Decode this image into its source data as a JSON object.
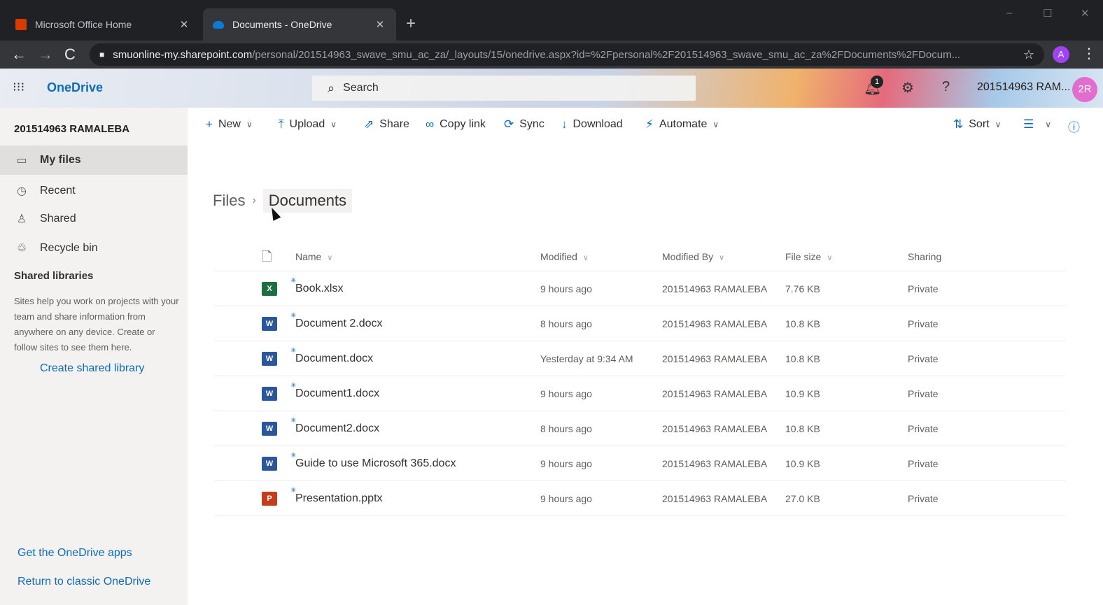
{
  "browser": {
    "tabs": [
      {
        "title": "Microsoft Office Home",
        "close": "✕",
        "icon": "office-icon"
      },
      {
        "title": "Documents - OneDrive",
        "close": "✕",
        "icon": "onedrive-cloud-icon"
      }
    ],
    "new_tab": "+",
    "window_controls": {
      "minimize": "–",
      "maximize": "☐",
      "close": "✕"
    },
    "url_host": "smuonline-my.sharepoint.com",
    "url_path": "/personal/201514963_swave_smu_ac_za/_layouts/15/onedrive.aspx?id=%2Fpersonal%2F201514963_swave_smu_ac_za%2FDocuments%2FDocum...",
    "profile_initial": "A"
  },
  "suite": {
    "app_name": "OneDrive",
    "search_placeholder": "Search",
    "notification_count": "1",
    "user_name": "201514963 RAM...",
    "avatar_initials": "2R"
  },
  "leftnav": {
    "owner": "201514963 RAMALEBA",
    "items": [
      {
        "label": "My files",
        "icon": "folder-icon",
        "selected": true
      },
      {
        "label": "Recent",
        "icon": "clock-icon"
      },
      {
        "label": "Shared",
        "icon": "people-icon"
      },
      {
        "label": "Recycle bin",
        "icon": "recycle-bin-icon"
      }
    ],
    "shared_libraries_heading": "Shared libraries",
    "shared_libraries_text": "Sites help you work on projects with your team and share information from anywhere on any device. Create or follow sites to see them here.",
    "create_shared_library": "Create shared library",
    "get_apps": "Get the OneDrive apps",
    "return_classic": "Return to classic OneDrive"
  },
  "commands": {
    "new": "New",
    "upload": "Upload",
    "share": "Share",
    "copy_link": "Copy link",
    "sync": "Sync",
    "download": "Download",
    "automate": "Automate",
    "sort": "Sort"
  },
  "breadcrumb": {
    "root": "Files",
    "current": "Documents"
  },
  "columns": {
    "name": "Name",
    "modified": "Modified",
    "modified_by": "Modified By",
    "file_size": "File size",
    "sharing": "Sharing"
  },
  "files": [
    {
      "name": "Book.xlsx",
      "type": "excel",
      "modified": "9 hours ago",
      "modified_by": "201514963 RAMALEBA",
      "size": "7.76 KB",
      "sharing": "Private"
    },
    {
      "name": "Document 2.docx",
      "type": "word",
      "modified": "8 hours ago",
      "modified_by": "201514963 RAMALEBA",
      "size": "10.8 KB",
      "sharing": "Private"
    },
    {
      "name": "Document.docx",
      "type": "word",
      "modified": "Yesterday at 9:34 AM",
      "modified_by": "201514963 RAMALEBA",
      "size": "10.8 KB",
      "sharing": "Private"
    },
    {
      "name": "Document1.docx",
      "type": "word",
      "modified": "9 hours ago",
      "modified_by": "201514963 RAMALEBA",
      "size": "10.9 KB",
      "sharing": "Private"
    },
    {
      "name": "Document2.docx",
      "type": "word",
      "modified": "8 hours ago",
      "modified_by": "201514963 RAMALEBA",
      "size": "10.8 KB",
      "sharing": "Private"
    },
    {
      "name": "Guide to use Microsoft 365.docx",
      "type": "word",
      "modified": "9 hours ago",
      "modified_by": "201514963 RAMALEBA",
      "size": "10.9 KB",
      "sharing": "Private"
    },
    {
      "name": "Presentation.pptx",
      "type": "powerpoint",
      "modified": "9 hours ago",
      "modified_by": "201514963 RAMALEBA",
      "size": "27.0 KB",
      "sharing": "Private"
    }
  ],
  "colors": {
    "accent": "#0f6cbd",
    "excel": "#1d6f42",
    "word": "#2b579a",
    "powerpoint": "#c43e1c",
    "avatar": "#e36ccf"
  }
}
